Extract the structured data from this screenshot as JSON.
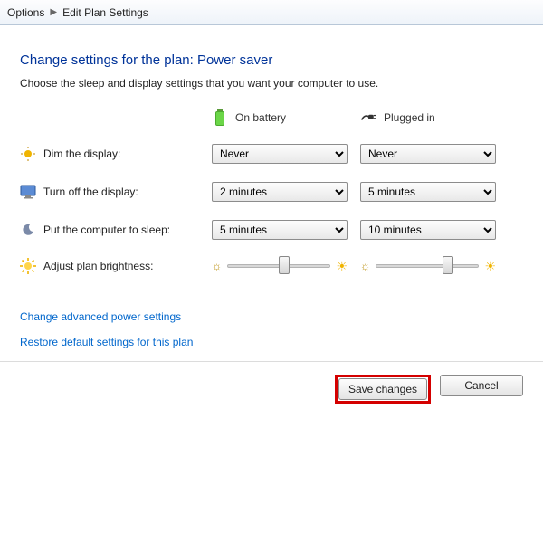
{
  "breadcrumb": {
    "options": "Options",
    "edit_plan": "Edit Plan Settings"
  },
  "heading": "Change settings for the plan: Power saver",
  "description": "Choose the sleep and display settings that you want your computer to use.",
  "columns": {
    "battery": "On battery",
    "plugged": "Plugged in"
  },
  "rows": {
    "dim": {
      "label": "Dim the display:",
      "battery": "Never",
      "plugged": "Never"
    },
    "turnoff": {
      "label": "Turn off the display:",
      "battery": "2 minutes",
      "plugged": "5 minutes"
    },
    "sleep": {
      "label": "Put the computer to sleep:",
      "battery": "5 minutes",
      "plugged": "10 minutes"
    },
    "brightness": {
      "label": "Adjust plan brightness:",
      "battery_pct": 55,
      "plugged_pct": 70
    }
  },
  "links": {
    "advanced": "Change advanced power settings",
    "restore": "Restore default settings for this plan"
  },
  "buttons": {
    "save": "Save changes",
    "cancel": "Cancel"
  }
}
